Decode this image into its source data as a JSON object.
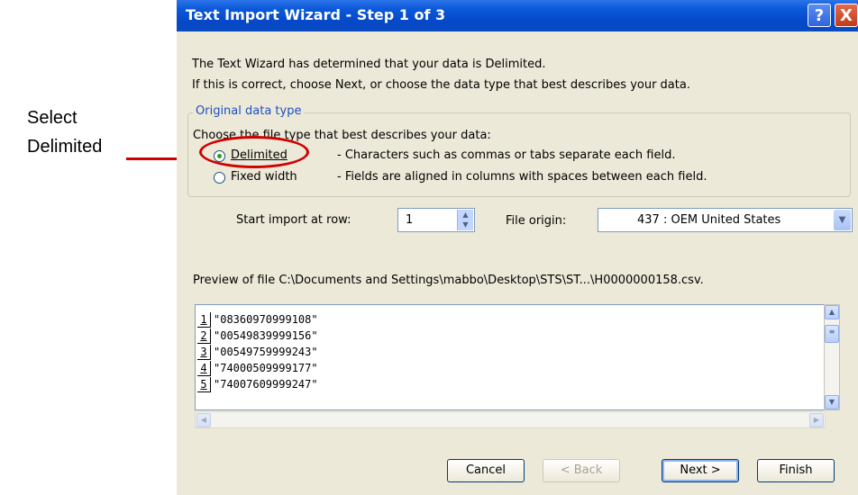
{
  "annotation": {
    "line1": "Select",
    "line2": "Delimited",
    "color": "#d10000"
  },
  "dialog": {
    "title": "Text Import Wizard - Step 1 of 3",
    "help_button": "?",
    "close_button": "X",
    "intro_line1": "The Text Wizard has determined that your data is Delimited.",
    "intro_line2": "If this is correct, choose Next, or choose the data type that best describes your data.",
    "group_label": "Original data type",
    "choose_label": "Choose the file type that best describes your data:",
    "options": [
      {
        "label": "Delimited",
        "description": "- Characters such as commas or tabs separate each field.",
        "selected": true
      },
      {
        "label": "Fixed width",
        "description": "- Fields are aligned in columns with spaces between each field.",
        "selected": false
      }
    ],
    "start_row_label": "Start import at row:",
    "start_row_value": "1",
    "file_origin_label": "File origin:",
    "file_origin_value": "437 : OEM United States",
    "preview_label": "Preview of file C:\\Documents and Settings\\mabbo\\Desktop\\STS\\ST...\\H0000000158.csv.",
    "preview_rows": [
      {
        "num": "1",
        "data": "\"08360970999108\""
      },
      {
        "num": "2",
        "data": "\"00549839999156\""
      },
      {
        "num": "3",
        "data": "\"00549759999243\""
      },
      {
        "num": "4",
        "data": "\"74000509999177\""
      },
      {
        "num": "5",
        "data": "\"74007609999247\""
      }
    ],
    "buttons": {
      "cancel": "Cancel",
      "back": "< Back",
      "next": "Next >",
      "finish": "Finish"
    }
  }
}
